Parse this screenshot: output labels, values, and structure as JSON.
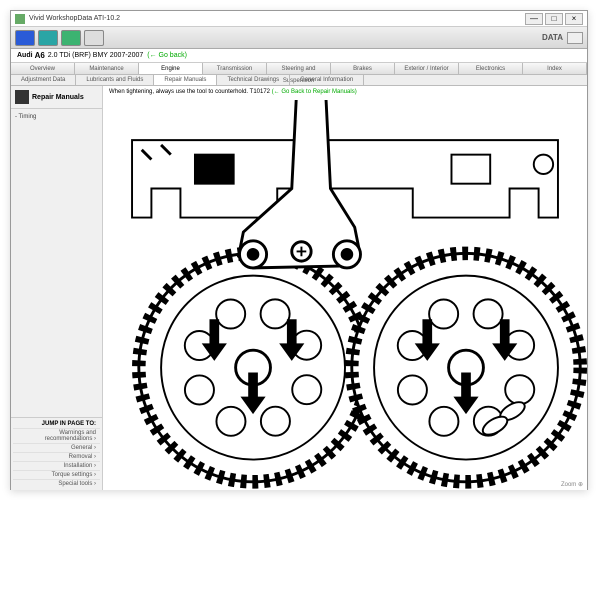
{
  "window": {
    "title": "Vivid WorkshopData ATI-10.2"
  },
  "toolbar": {
    "logo_text": "DATA"
  },
  "vehicle": {
    "brand": "Audi",
    "model": "A6",
    "spec": "2.0 TDi (BRF) BMY 2007-2007",
    "back_link": "(← Go back)"
  },
  "tabs": {
    "row1": [
      "Overview",
      "Maintenance",
      "Engine",
      "Transmission",
      "Steering and Suspension",
      "Brakes",
      "Exterior / Interior",
      "Electronics",
      "Index"
    ],
    "active1": 2,
    "row2": [
      "Adjustment Data",
      "Lubricants and Fluids",
      "Repair Manuals",
      "Technical Drawings",
      "General Information"
    ],
    "active2": 2
  },
  "sidebar": {
    "title": "Repair Manuals",
    "tree": [
      "- Timing"
    ],
    "jump_title": "JUMP IN PAGE TO:",
    "jump_items": [
      "Warnings and recommendations ›",
      "General ›",
      "Removal ›",
      "Installation ›",
      "Torque settings ›",
      "Special tools ›"
    ]
  },
  "instruction": {
    "text": "When tightening, always use the tool to counterhold.",
    "tool_code": "T10172",
    "back_link": "(← Go Back to Repair Manuals)"
  },
  "zoom": "Zoom ⊕"
}
